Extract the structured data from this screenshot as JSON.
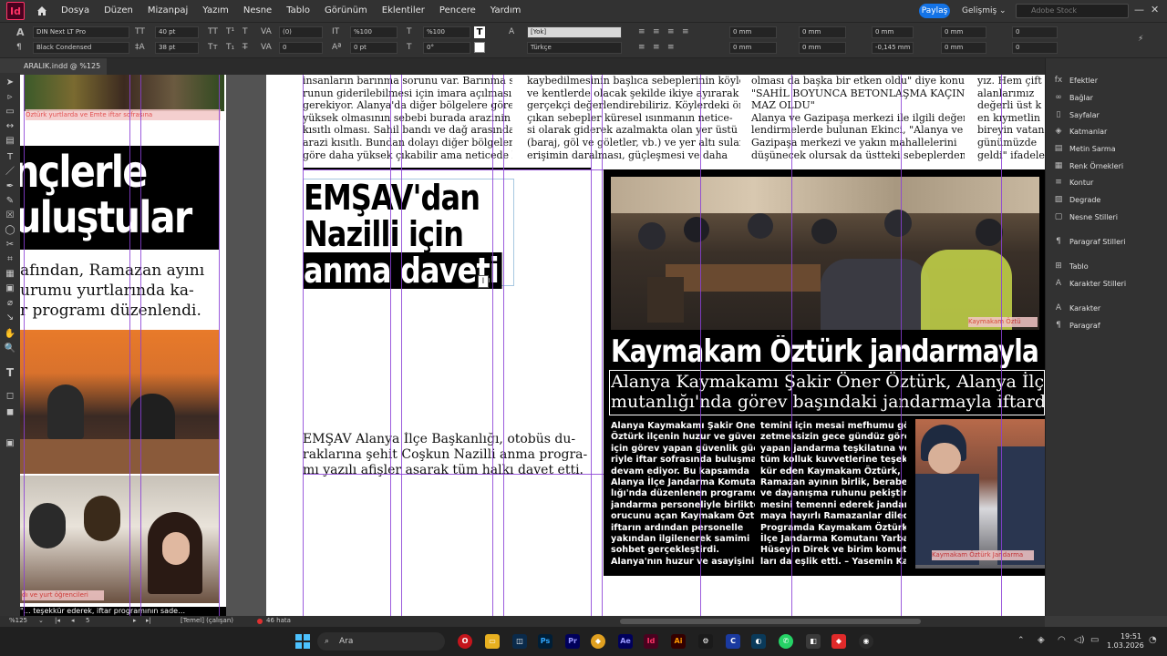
{
  "menubar": {
    "logo": "Id",
    "items": [
      "Dosya",
      "Düzen",
      "Mizanpaj",
      "Yazım",
      "Nesne",
      "Tablo",
      "Görünüm",
      "Eklentiler",
      "Pencere",
      "Yardım"
    ],
    "share": "Paylaş",
    "workspace": "Gelişmiş",
    "stock_placeholder": "Adobe Stock"
  },
  "controlbar": {
    "font_family": "DIN Next LT Pro",
    "font_style": "Black Condensed",
    "font_size": "40 pt",
    "leading": "38 pt",
    "kerning": "(0)",
    "tracking": "0",
    "vscale": "%100",
    "hscale": "%100",
    "baseline": "0 pt",
    "skew": "0°",
    "char_style": "[Yok]",
    "language": "Türkçe",
    "indent1": "0 mm",
    "indent2": "0 mm",
    "indent3": "0 mm",
    "indent4": "0 mm",
    "indent5": "0 mm",
    "indent6": "-0,145 mm",
    "space1": "0 mm",
    "space2": "0 mm",
    "drop1": "0",
    "drop2": "0"
  },
  "doctab": {
    "label": "ARALIK.indd @ %125"
  },
  "left_page": {
    "headline_line1": "nçlerle",
    "headline_line2": "uluştular",
    "sub_line1": "afından, Ramazan ayını",
    "sub_line2": "urumu yurtlarında ka-",
    "sub_line3": "r programı düzenlendi.",
    "top_caption": "Öztürk yurtlarda ve Emte iftar sofrasına",
    "photo_caption": "dı ve yurt öğrencileri",
    "bottom_line": "\"… teşekkür ederek, iftar programının sade…"
  },
  "col1_text": [
    "insanların barınma sorunu var. Barınma so-",
    "runun giderilebilmesi için imara açılması",
    "gerekiyor. Alanya'da diğer bölgelere göre",
    "yüksek olmasının sebebi burada arazinin",
    "kısıtlı olması. Sahil bandı ve dağ arasındaki",
    "arazi kısıtlı. Bundan dolayı diğer bölgelere",
    "göre daha yüksek çıkabilir ama neticede bu"
  ],
  "col2_text": [
    "kaybedilmesinin başlıca sebeplerinin köylerde",
    "ve kentlerde olacak şekilde ikiye ayırarak",
    "gerçekçi değerlendirebiliriz. Köylerdeki öne",
    "çıkan sebepler küresel ısınmanın netice-",
    "si olarak giderek azalmakta olan yer üstü",
    "(baraj, göl ve göletler, vb.) ve yer altı sularına",
    "erişimin daralması, güçleşmesi ve daha"
  ],
  "col3_text": [
    "olması da başka bir etken oldu\" diye konuştu.",
    "\"SAHİL BOYUNCA BETONLAŞMA KAÇINIL-",
    "MAZ OLDU\"",
    "Alanya ve Gazipaşa merkezi ile ilgili değer-",
    "lendirmelerde bulunan Ekinci, \"Alanya ve",
    "Gazipaşa merkezi ve yakın mahallelerini",
    "düşünecek olursak da üstteki sebeplerden"
  ],
  "col4_text": [
    "yız. Hem çift",
    "alanlarımız",
    "değerli üst k",
    "en kıymetlin",
    "bireyin vatan",
    "günümüzde",
    "geldi\" ifadele"
  ],
  "emsav": {
    "head1": "EMŞAV'dan",
    "head2": "Nazilli için",
    "head3": "anma daveti",
    "body1": "EMŞAV Alanya İlçe Başkanlığı, otobüs du-",
    "body2": "raklarına şehit Coşkun Nazilli anma progra-",
    "body3": "mı yazılı afişler asarak tüm halkı davet etti."
  },
  "kaymakam": {
    "headline": "Kaymakam Öztürk jandarmayla ifta",
    "sub1": "Alanya Kaymakamı Şakir Öner Öztürk, Alanya İlç",
    "sub2": "mutanlığı'nda görev başındaki jandarmayla iftard",
    "photo_caption": "Kaymakam Öztü",
    "photo2_caption": "Kaymakam Öztürk Jandarma",
    "colA": [
      "Alanya Kaymakamı Şakir Öner",
      "Öztürk ilçenin huzur ve güvenliği",
      "için görev yapan güvenlik güçle-",
      "riyle iftar sofrasında buluşmaya",
      "devam ediyor. Bu kapsamda",
      "Alanya İlçe Jandarma Komutan-",
      "lığı'nda düzenlenen programda",
      "jandarma personeliyle birlikte",
      "orucunu açan Kaymakam Öztürk",
      "iftarın ardından personelle",
      "yakından ilgilenerek samimi",
      "sohbet gerçekleştirdi.",
      "Alanya'nın huzur ve asayişinin"
    ],
    "colB": [
      "temini için mesai mefhumu gö-",
      "zetmeksizin gece gündüz görev",
      "yapan jandarma teşkilatına ve",
      "tüm kolluk kuvvetlerine teşek-",
      "kür eden Kaymakam Öztürk,",
      "Ramazan ayının birlik, beraberlik",
      "ve dayanışma ruhunu pekiştir-",
      "mesini temenni ederek jandar-",
      "maya hayırlı Ramazanlar diledi.",
      "Programda Kaymakam  Öztürk'e",
      "İlçe Jandarma Komutanı Yarbay",
      "Hüseyin Direk ve birim komutan-",
      "ları da eşlik etti. – Yasemin Kaya"
    ]
  },
  "rightpanel": {
    "items": [
      {
        "label": "Efektler",
        "icon": "fx-icon"
      },
      {
        "label": "Bağlar",
        "icon": "link-icon"
      },
      {
        "label": "Sayfalar",
        "icon": "pages-icon"
      },
      {
        "label": "Katmanlar",
        "icon": "layers-icon"
      },
      {
        "label": "Metin Sarma",
        "icon": "text-wrap-icon"
      },
      {
        "label": "Renk Örnekleri",
        "icon": "swatches-icon"
      },
      {
        "label": "Kontur",
        "icon": "stroke-icon"
      },
      {
        "label": "Degrade",
        "icon": "gradient-icon"
      },
      {
        "label": "Nesne Stilleri",
        "icon": "object-styles-icon"
      },
      {
        "label": "Paragraf Stilleri",
        "icon": "paragraph-styles-icon"
      },
      {
        "label": "Tablo",
        "icon": "table-icon"
      },
      {
        "label": "Karakter Stilleri",
        "icon": "char-styles-icon"
      },
      {
        "label": "Karakter",
        "icon": "character-icon"
      },
      {
        "label": "Paragraf",
        "icon": "paragraph-icon"
      }
    ]
  },
  "statusbar": {
    "zoom": "%125",
    "page": "5",
    "style": "[Temel] (çalışan)",
    "errors": "46 hata"
  },
  "taskbar": {
    "search": "Ara",
    "time": "19:51",
    "date": "1.03.2026"
  },
  "colors": {
    "guide": "#8b3fd6",
    "accent": "#1473e6",
    "indesign": "#ff3366"
  }
}
